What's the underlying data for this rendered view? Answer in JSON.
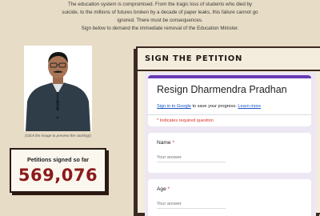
{
  "intro": {
    "line1": "The education system is compromised. From the tragic loss of students who died by",
    "line2": "suicide, to the millions of futures broken by a decade of paper leaks, this failure cannot go",
    "line3": "ignored. There must be consequences.",
    "line4": "Sign below to demand the immediate removal of the Education Minister."
  },
  "portrait": {
    "caption": "(Click the image to preview the sacking!)"
  },
  "counter": {
    "label": "Petitions signed so far",
    "value": "569,076"
  },
  "petition": {
    "heading": "SIGN THE PETITION",
    "form": {
      "title": "Resign Dharmendra Pradhan",
      "signin_link": "Sign in to Google",
      "signin_text": " to save your progress. ",
      "learn_more": "Learn more",
      "required_note": "* Indicates required question",
      "questions": [
        {
          "label": "Name",
          "required": "*",
          "placeholder": "Your answer"
        },
        {
          "label": "Age",
          "required": "*",
          "placeholder": "Your answer"
        }
      ]
    }
  },
  "colors": {
    "page_bg": "#e7dcc6",
    "counter_value": "#8b1a1a",
    "form_accent": "#673ab7",
    "required": "#d93025",
    "link": "#1a56c7"
  }
}
